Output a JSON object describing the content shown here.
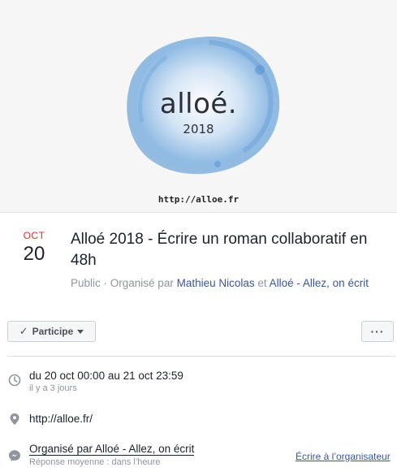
{
  "cover": {
    "brand": "alloé.",
    "year": "2018",
    "url": "http://alloe.fr"
  },
  "date": {
    "month": "OCT",
    "day": "20"
  },
  "event": {
    "title": "Alloé 2018 - Écrire un roman collaboratif en 48h",
    "privacy": "Public",
    "separator": " · ",
    "organized_by": "Organisé par ",
    "host1": "Mathieu Nicolas",
    "and": " et ",
    "host2": "Alloé - Allez, on écrit"
  },
  "actions": {
    "going_label": "Participe",
    "check_icon": "✓",
    "more_label": "···"
  },
  "details": {
    "when": "du 20 oct 00:00 au 21 oct 23:59",
    "when_relative": "il y a 3 jours",
    "location": "http://alloe.fr/",
    "organizer": "Organisé par Alloé - Allez, on écrit",
    "response_time": "Réponse moyenne : dans l’heure",
    "contact_label": "Écrire à l’organisateur"
  },
  "icons": {
    "clock": "clock-icon",
    "pin": "location-pin-icon",
    "messenger": "messenger-icon",
    "check": "check-icon",
    "caret": "caret-down-icon",
    "more": "more-options-icon"
  },
  "colors": {
    "month_red": "#e02d2d",
    "link_blue": "#385898",
    "watercolor_blue": "#6fa6d8"
  }
}
